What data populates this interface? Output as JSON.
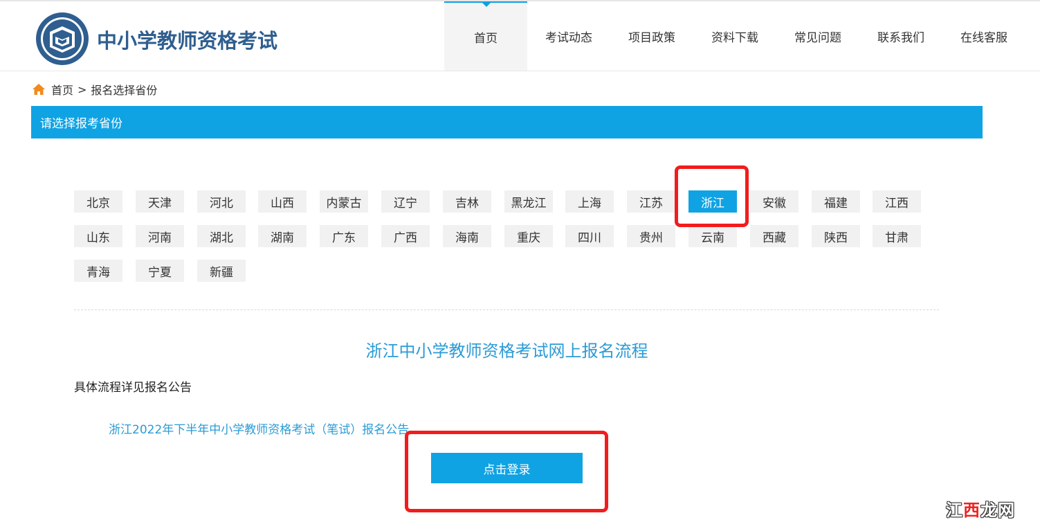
{
  "header": {
    "site_title": "中小学教师资格考试",
    "nav": [
      "首页",
      "考试动态",
      "项目政策",
      "资料下载",
      "常见问题",
      "联系我们",
      "在线客服"
    ],
    "active_nav": "首页"
  },
  "breadcrumb": {
    "home": "首页",
    "separator": ">",
    "current": "报名选择省份"
  },
  "section": {
    "title": "请选择报考省份"
  },
  "provinces": {
    "row1": [
      "北京",
      "天津",
      "河北",
      "山西",
      "内蒙古",
      "辽宁",
      "吉林",
      "黑龙江",
      "上海",
      "江苏",
      "浙江",
      "安徽",
      "福建",
      "江西"
    ],
    "row2": [
      "山东",
      "河南",
      "湖北",
      "湖南",
      "广东",
      "广西",
      "海南",
      "重庆",
      "四川",
      "贵州",
      "云南",
      "西藏",
      "陕西",
      "甘肃"
    ],
    "row3": [
      "青海",
      "宁夏",
      "新疆"
    ],
    "selected": "浙江"
  },
  "flow": {
    "title": "浙江中小学教师资格考试网上报名流程",
    "description": "具体流程详见报名公告",
    "notice_link": "浙江2022年下半年中小学教师资格考试（笔试）报名公告",
    "login_button": "点击登录"
  },
  "watermark": {
    "part1": "江",
    "part2": "西",
    "part3": "龙网"
  },
  "colors": {
    "accent_blue": "#10a3e3",
    "title_blue": "#2f5e8f",
    "link_blue": "#2b9bd6",
    "highlight_red": "#f21c1c"
  },
  "icons": {
    "logo": "teacher-certification-logo",
    "home": "home-icon",
    "nav_active": "caret-down-icon"
  }
}
